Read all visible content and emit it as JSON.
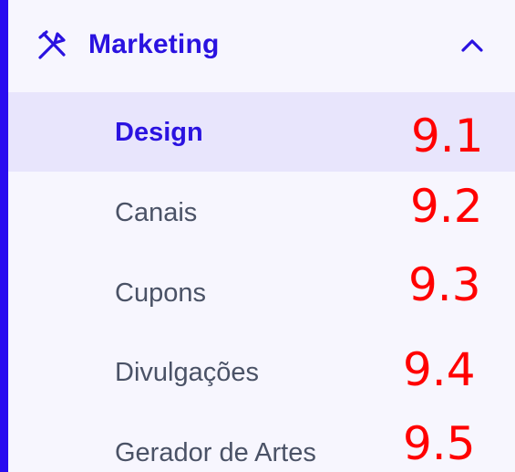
{
  "section": {
    "title": "Marketing",
    "icon": "tools-icon",
    "toggle_icon": "chevron-up-icon",
    "accent_color": "#2a0cf0"
  },
  "items": [
    {
      "label": "Design",
      "annotation": "9.1",
      "active": true
    },
    {
      "label": "Canais",
      "annotation": "9.2",
      "active": false
    },
    {
      "label": "Cupons",
      "annotation": "9.3",
      "active": false
    },
    {
      "label": "Divulgações",
      "annotation": "9.4",
      "active": false
    },
    {
      "label": "Gerador de Artes",
      "annotation": "9.5",
      "active": false
    }
  ]
}
